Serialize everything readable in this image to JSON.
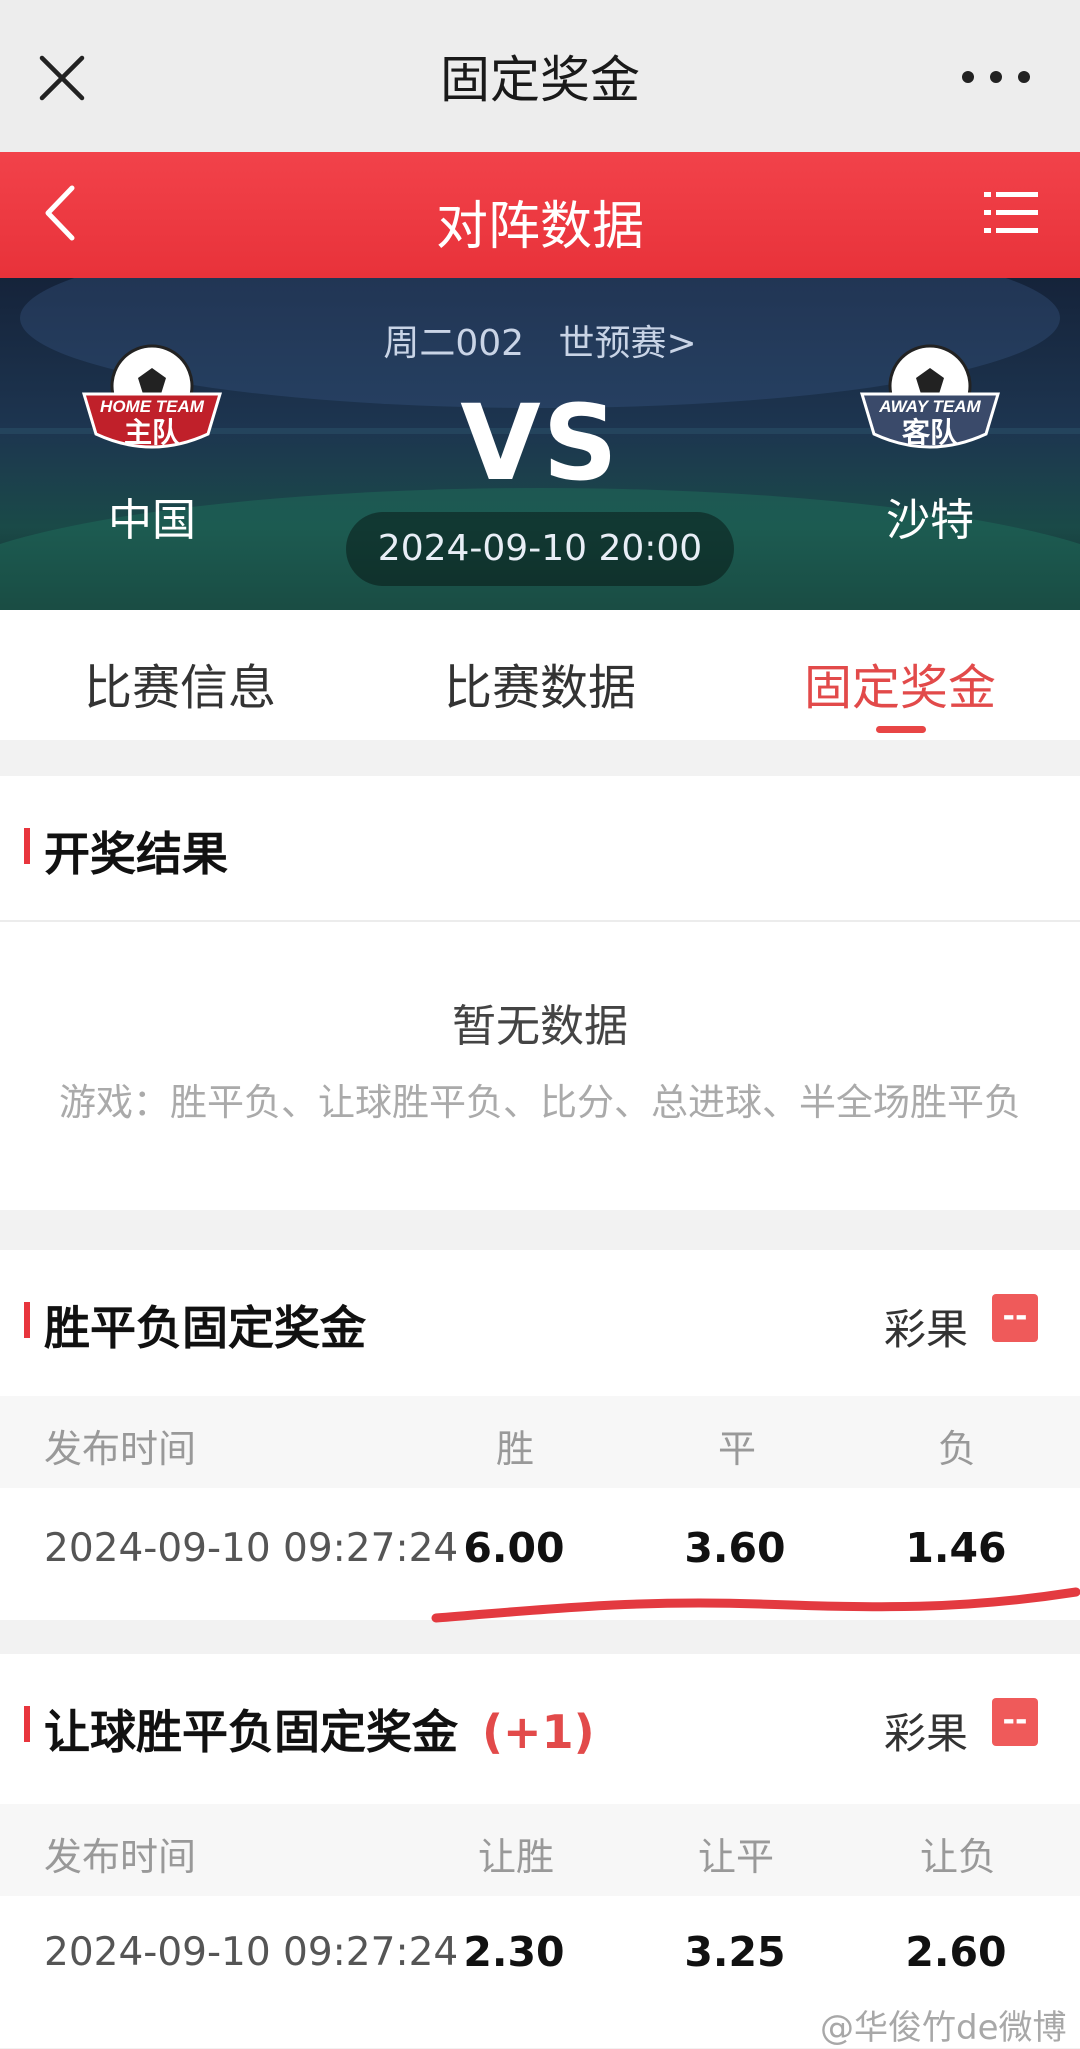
{
  "topbar": {
    "title": "固定奖金"
  },
  "header": {
    "title": "对阵数据"
  },
  "match": {
    "code": "周二002",
    "league": "世预赛>",
    "vs": "VS",
    "time": "2024-09-10 20:00",
    "home": {
      "badge_line1": "HOME TEAM",
      "badge_line2": "主队",
      "name": "中国"
    },
    "away": {
      "badge_line1": "AWAY TEAM",
      "badge_line2": "客队",
      "name": "沙特"
    }
  },
  "tabs": [
    {
      "label": "比赛信息"
    },
    {
      "label": "比赛数据"
    },
    {
      "label": "固定奖金"
    }
  ],
  "results": {
    "title": "开奖结果",
    "empty": "暂无数据",
    "games": "游戏：胜平负、让球胜平负、比分、总进球、半全场胜平负"
  },
  "wdl": {
    "title": "胜平负固定奖金",
    "source": "彩果",
    "source_value": "--",
    "headers": [
      "发布时间",
      "胜",
      "平",
      "负"
    ],
    "rows": [
      {
        "time": "2024-09-10 09:27:24",
        "win": "6.00",
        "draw": "3.60",
        "lose": "1.46"
      }
    ]
  },
  "handicap": {
    "title": "让球胜平负固定奖金",
    "handicap": "(+1)",
    "source": "彩果",
    "source_value": "--",
    "headers": [
      "发布时间",
      "让胜",
      "让平",
      "让负"
    ],
    "rows": [
      {
        "time": "2024-09-10 09:27:24",
        "win": "2.30",
        "draw": "3.25",
        "lose": "2.60"
      }
    ]
  },
  "watermark": "@华俊竹de微博",
  "colors": {
    "accent": "#e8353d",
    "tab_active": "#e24a4a",
    "source_badge": "#ef5a5a"
  }
}
